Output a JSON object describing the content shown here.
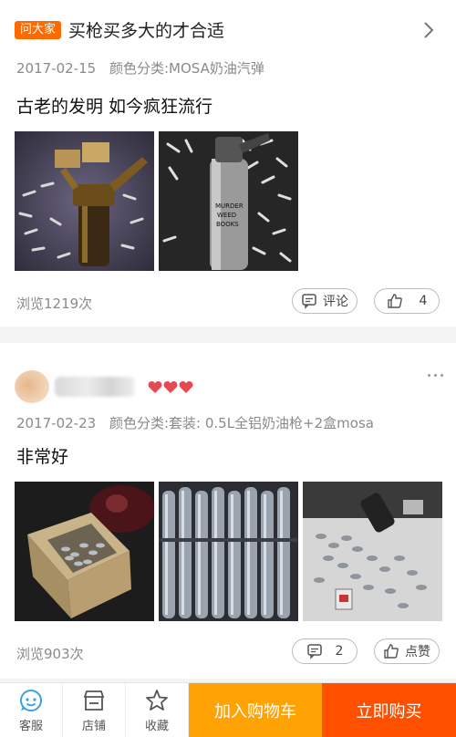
{
  "ask_bar": {
    "badge": "问大家",
    "question": "买枪买多大的才合适"
  },
  "reviews": [
    {
      "date": "2017-02-15",
      "variant": "颜色分类:MOSA奶油汽弹",
      "text": "古老的发明 如今疯狂流行",
      "photo_text": [
        "MURDER",
        "WEED",
        "BOOKS"
      ],
      "views": "浏览1219次",
      "comment_label": "评论",
      "like_label": "4"
    },
    {
      "date": "2017-02-23",
      "variant": "颜色分类:套装:  0.5L全铝奶油枪+2盒mosa",
      "text": "非常好",
      "views": "浏览903次",
      "comment_label": "2",
      "like_label": "点赞"
    }
  ],
  "bottom_bar": {
    "service": "客服",
    "shop": "店铺",
    "favorite": "收藏",
    "add_to_cart": "加入购物车",
    "buy_now": "立即购买"
  },
  "colors": {
    "accent_orange": "#ff6a00",
    "cart_button": "#ffa203",
    "buy_button": "#ff5000",
    "service_icon": "#3aa1e8",
    "heart": "#e8484f"
  }
}
